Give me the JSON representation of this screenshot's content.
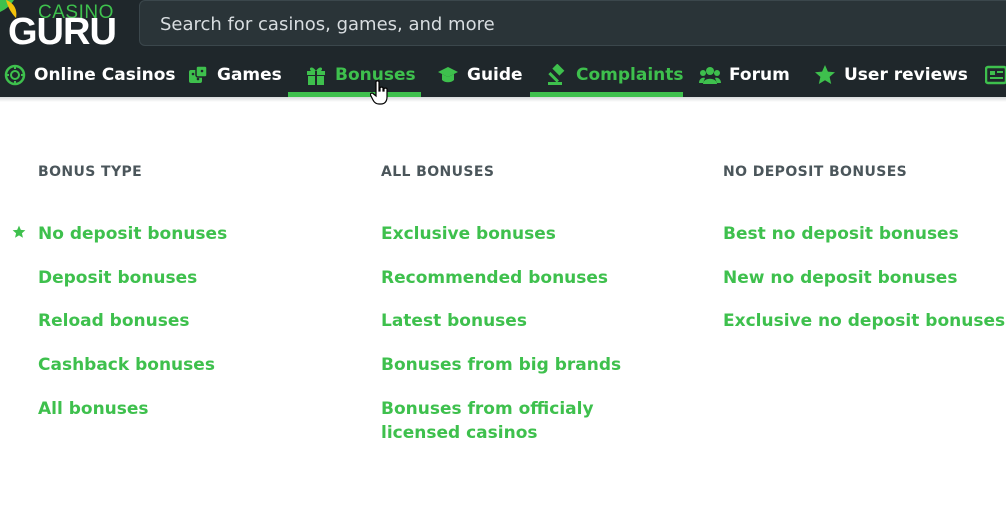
{
  "logo": {
    "top_text": "CASINO",
    "main_text": "GURU"
  },
  "search": {
    "placeholder": "Search for casinos, games, and more"
  },
  "nav": {
    "items": [
      {
        "label": "Online Casinos",
        "icon": "casino-chip-icon"
      },
      {
        "label": "Games",
        "icon": "dice-icon"
      },
      {
        "label": "Bonuses",
        "icon": "gift-icon",
        "active": true
      },
      {
        "label": "Guide",
        "icon": "graduation-cap-icon"
      },
      {
        "label": "Complaints",
        "icon": "gavel-icon",
        "active": true
      },
      {
        "label": "Forum",
        "icon": "users-icon"
      },
      {
        "label": "User reviews",
        "icon": "star-icon"
      }
    ]
  },
  "menu": {
    "columns": [
      {
        "title": "BONUS TYPE",
        "links": [
          "No deposit bonuses",
          "Deposit bonuses",
          "Reload bonuses",
          "Cashback bonuses",
          "All bonuses"
        ]
      },
      {
        "title": "ALL BONUSES",
        "links": [
          "Exclusive bonuses",
          "Recommended bonuses",
          "Latest bonuses",
          "Bonuses from big brands",
          "Bonuses from officialy licensed casinos"
        ]
      },
      {
        "title": "NO DEPOSIT BONUSES",
        "links": [
          "Best no deposit bonuses",
          "New no deposit bonuses",
          "Exclusive no deposit bonuses"
        ]
      }
    ]
  },
  "colors": {
    "accent": "#3ec04d",
    "header_bg": "#1f272b",
    "heading": "#4b565b"
  }
}
